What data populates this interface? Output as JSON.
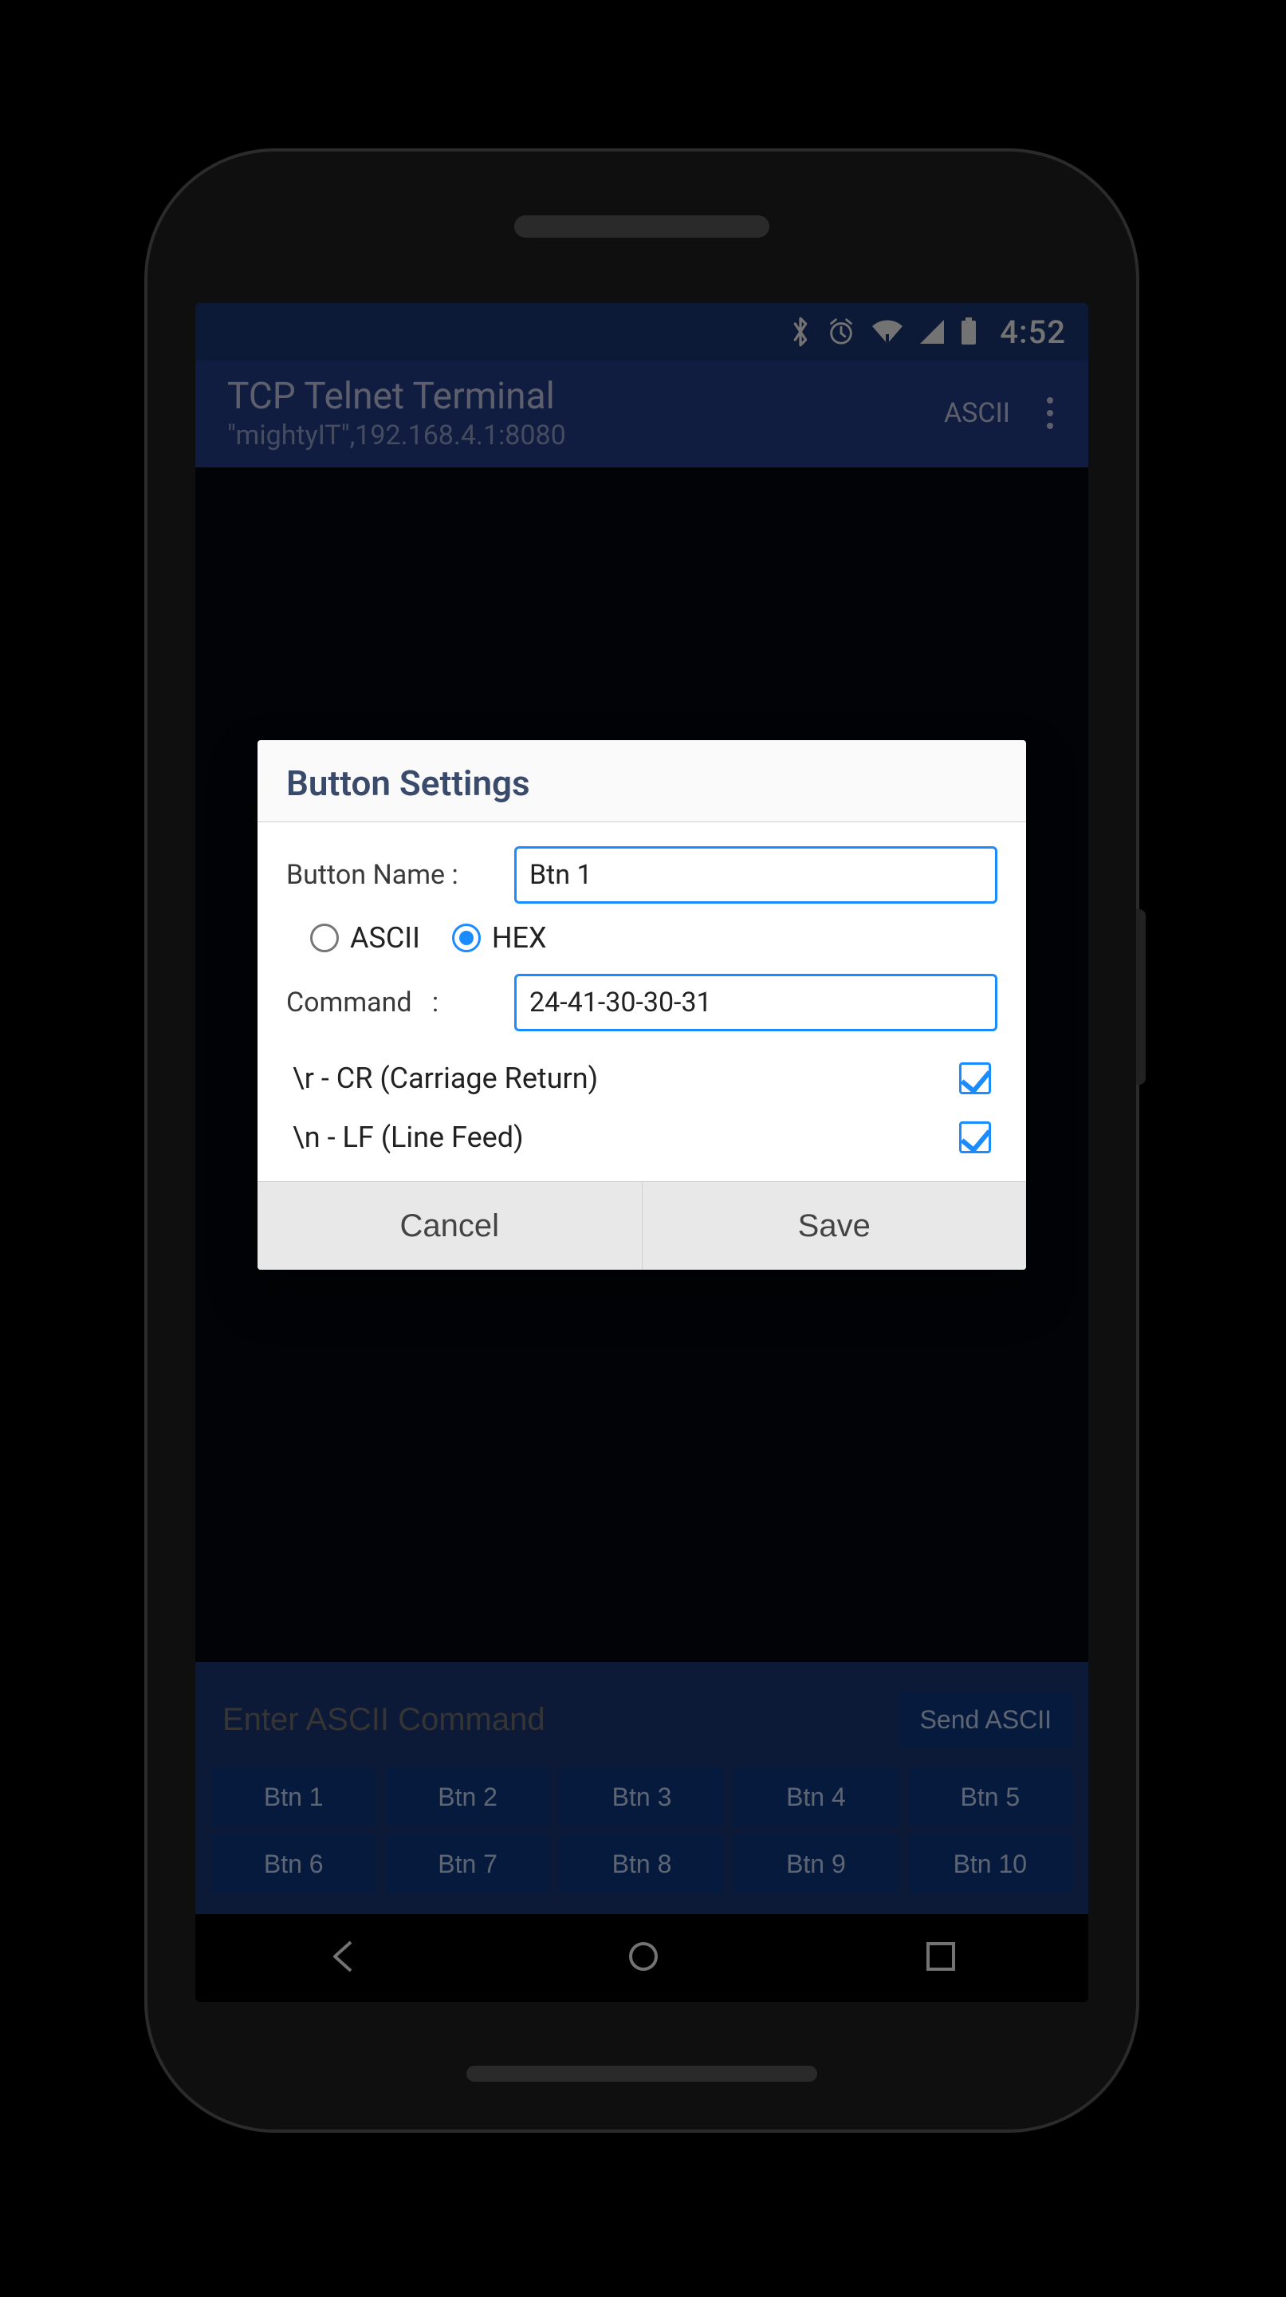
{
  "statusbar": {
    "time": "4:52"
  },
  "appbar": {
    "title": "TCP Telnet Terminal",
    "subtitle": "\"mightyIT\",192.168.4.1:8080",
    "mode": "ASCII"
  },
  "cmdbar": {
    "placeholder": "Enter ASCII Command",
    "send_label": "Send ASCII"
  },
  "quick_buttons_row1": [
    "Btn 1",
    "Btn 2",
    "Btn 3",
    "Btn 4",
    "Btn 5"
  ],
  "quick_buttons_row2": [
    "Btn 6",
    "Btn 7",
    "Btn 8",
    "Btn 9",
    "Btn 10"
  ],
  "dialog": {
    "title": "Button Settings",
    "name_label": "Button Name",
    "name_value": "Btn 1",
    "radio_ascii": "ASCII",
    "radio_hex": "HEX",
    "radio_selected": "HEX",
    "command_label": "Command",
    "command_value": "24-41-30-30-31",
    "cr_label": "\\r - CR (Carriage Return)",
    "cr_checked": true,
    "lf_label": "\\n - LF (Line Feed)",
    "lf_checked": true,
    "cancel": "Cancel",
    "save": "Save"
  }
}
